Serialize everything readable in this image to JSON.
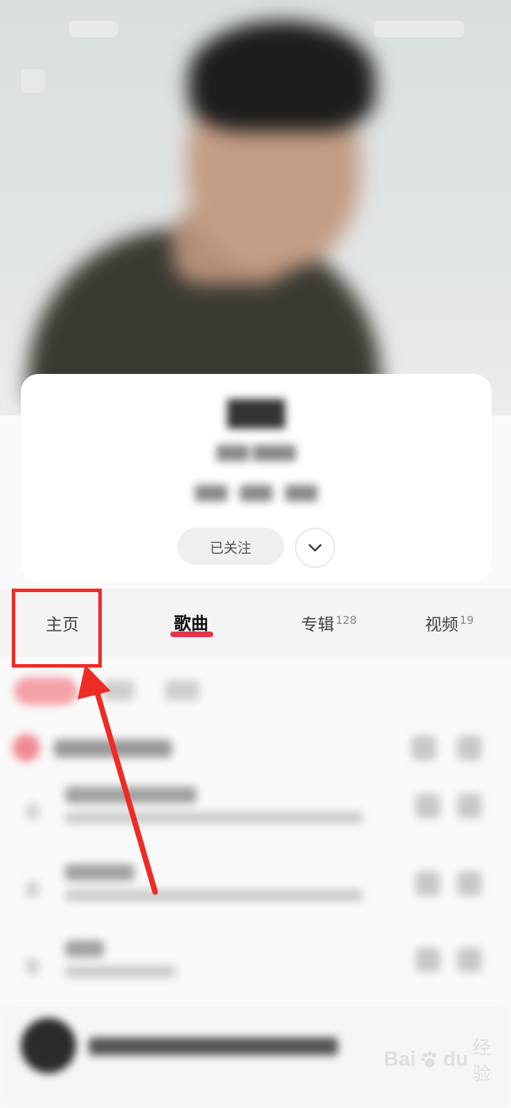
{
  "artist_card": {
    "follow_label": "已关注"
  },
  "tabs": [
    {
      "label": "主页",
      "count": ""
    },
    {
      "label": "歌曲",
      "count": ""
    },
    {
      "label": "专辑",
      "count": "128"
    },
    {
      "label": "视频",
      "count": "19"
    }
  ],
  "watermark": {
    "brand": "Bai",
    "brand_tail": "du",
    "suffix": "经验",
    "paw_icon": "paw-icon"
  },
  "colors": {
    "accent": "#e6344a",
    "annotation": "#ef2b26"
  }
}
